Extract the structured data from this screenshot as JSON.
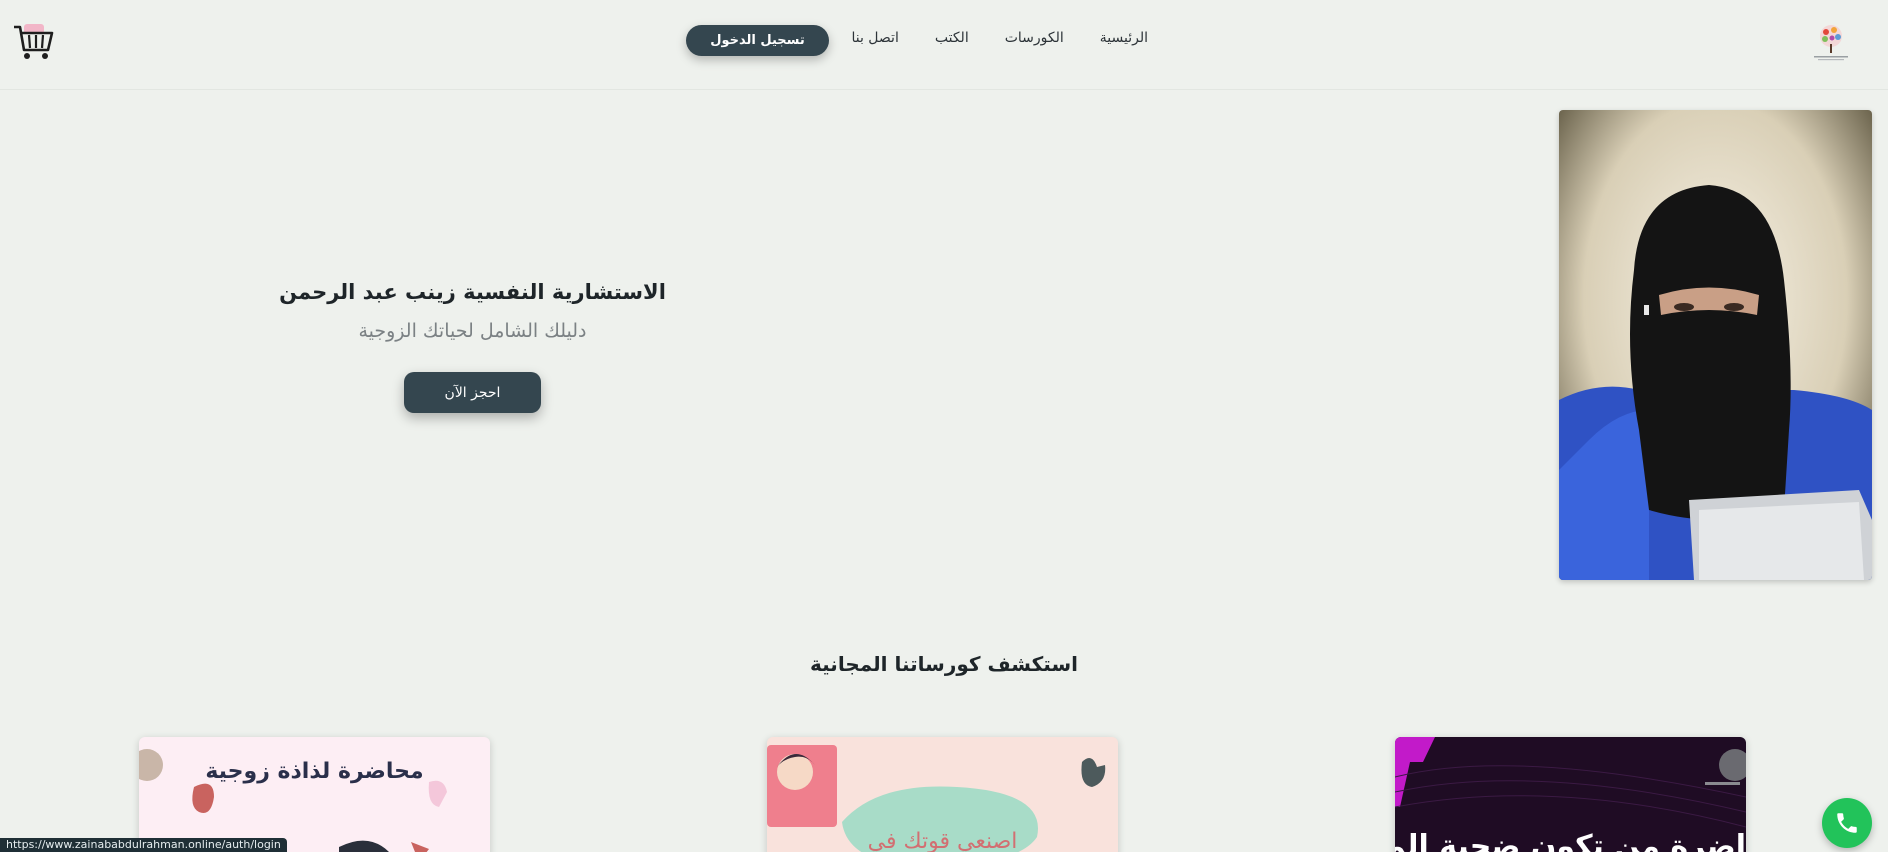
{
  "nav": {
    "items": [
      {
        "label": "الرئيسية"
      },
      {
        "label": "الكورسات"
      },
      {
        "label": "الكتب"
      },
      {
        "label": "اتصل بنا"
      }
    ],
    "login_label": "تسجيل الدخول"
  },
  "hero": {
    "title": "الاستشارية النفسية زينب عبد الرحمن",
    "subtitle": "دليلك الشامل لحياتك الزوجية",
    "cta_label": "احجز الآن"
  },
  "courses": {
    "heading": "استكشف كورساتنا المجانية",
    "cards": [
      {
        "title": "محاضرة لذاذة زوجية"
      },
      {
        "title": "اصنعي قوتك في"
      },
      {
        "title": "اضرة من تكون ضحية المؤذي؟"
      }
    ]
  },
  "status_bar": {
    "url": "https://www.zainababdulrahman.online/auth/login"
  },
  "colors": {
    "background": "#eef1ed",
    "primary_button": "#34464f",
    "whatsapp_green": "#22c35a"
  },
  "icons": [
    "logo-tree-icon",
    "cart-icon",
    "phone-icon"
  ]
}
